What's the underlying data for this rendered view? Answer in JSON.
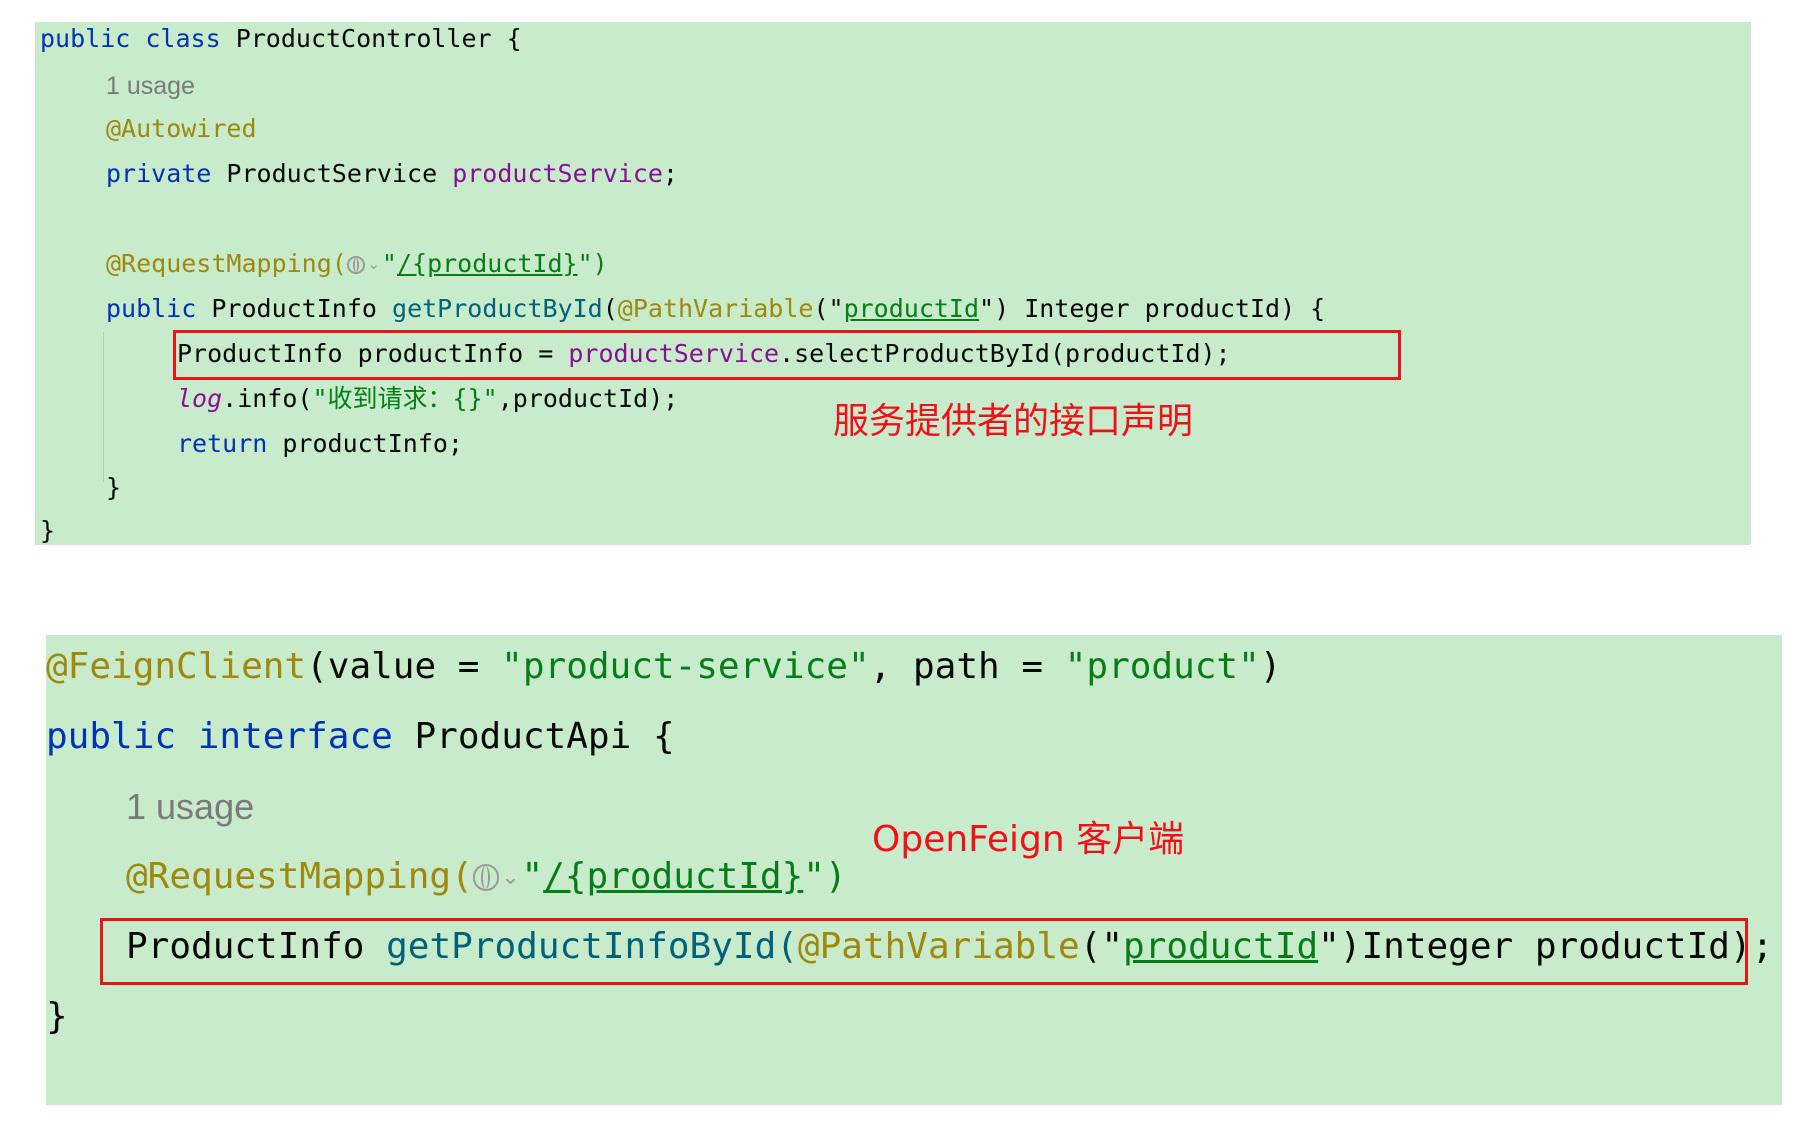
{
  "provider_snippet": {
    "class_declaration": {
      "kw_public": "public",
      "kw_class": "class",
      "class_name": "ProductController",
      "open_brace": "{"
    },
    "usage_hint": "1 usage",
    "autowired_annotation": "@Autowired",
    "field": {
      "kw_private": "private",
      "type": "ProductService",
      "name": "productService",
      "semicolon": ";"
    },
    "mapping": {
      "annotation": "@RequestMapping(",
      "quote_open": "\"",
      "path": "/{productId}",
      "quote_close_paren": "\")"
    },
    "method_signature": {
      "kw_public": "public",
      "return_type": "ProductInfo",
      "name": "getProductById",
      "annotation": "@PathVariable",
      "paren_quote": "(\"",
      "param_value": "productId",
      "quote_paren_rest": "\") Integer productId) {"
    },
    "body": {
      "assign_lhs": "ProductInfo productInfo = ",
      "service_ref": "productService",
      "call_rest": ".selectProductById(productId);",
      "log_ref": "log",
      "log_call": ".info(",
      "log_string": "\"收到请求：{}\"",
      "log_rest": ",productId);",
      "kw_return": "return",
      "return_rest": " productInfo;"
    },
    "method_close": "}",
    "class_close": "}"
  },
  "provider_callout": "服务提供者的接口声明",
  "client_snippet": {
    "feign_annotation": "@FeignClient",
    "feign_open": "(value = ",
    "feign_value": "\"product-service\"",
    "feign_comma": ", path = ",
    "feign_path": "\"product\"",
    "feign_close": ")",
    "kw_public": "public",
    "kw_interface": "interface",
    "interface_name": "ProductApi",
    "open_brace": "{",
    "usage_hint": "1 usage",
    "mapping": {
      "annotation": "@RequestMapping(",
      "quote_open": "\"",
      "path": "/{productId}",
      "quote_close_paren": "\")"
    },
    "method": {
      "return_type": "ProductInfo",
      "name": "getProductInfoById(",
      "annotation": "@PathVariable",
      "paren_quote": "(\"",
      "param_value": "productId",
      "rest": "\")Integer productId);"
    },
    "close_brace": "}"
  },
  "client_callout": "OpenFeign 客户端",
  "colors": {
    "panel_background": "#c8ebcb",
    "keyword": "#0033b3",
    "annotation": "#9e880d",
    "field": "#871094",
    "method": "#00627a",
    "string": "#067d17",
    "highlight_border": "#e8141c",
    "callout_text": "#f0101a"
  },
  "icons": [
    "globe-icon",
    "chevron-down-icon"
  ]
}
